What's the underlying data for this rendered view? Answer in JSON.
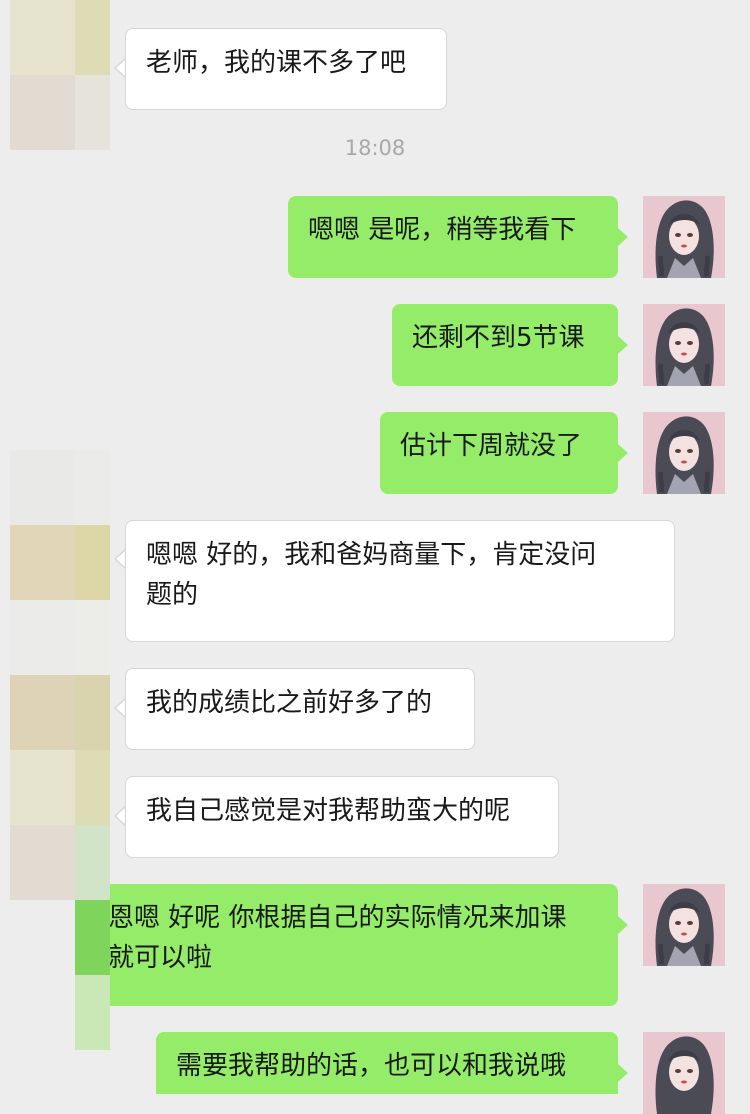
{
  "colors": {
    "background": "#ededed",
    "sent_bubble": "#95ec69",
    "received_bubble": "#ffffff",
    "timestamp": "#a8a8a8"
  },
  "timestamp": "18:08",
  "messages": [
    {
      "side": "received",
      "text": "老师，我的课不多了吧"
    },
    {
      "side": "sent",
      "text": "嗯嗯 是呢，稍等我看下"
    },
    {
      "side": "sent",
      "text": "还剩不到5节课"
    },
    {
      "side": "sent",
      "text": "估计下周就没了"
    },
    {
      "side": "received",
      "text": "嗯嗯 好的，我和爸妈商量下，肯定没问\n题的"
    },
    {
      "side": "received",
      "text": "我的成绩比之前好多了的"
    },
    {
      "side": "received",
      "text": "我自己感觉是对我帮助蛮大的呢"
    },
    {
      "side": "sent",
      "text": "恩嗯 好呢 你根据自己的实际情况来加课\n就可以啦"
    },
    {
      "side": "sent",
      "text": "需要我帮助的话，也可以和我说哦"
    }
  ],
  "avatar_icons": {
    "received": "pixelated-avatar-icon",
    "sent": "girl-portrait-avatar-icon"
  }
}
